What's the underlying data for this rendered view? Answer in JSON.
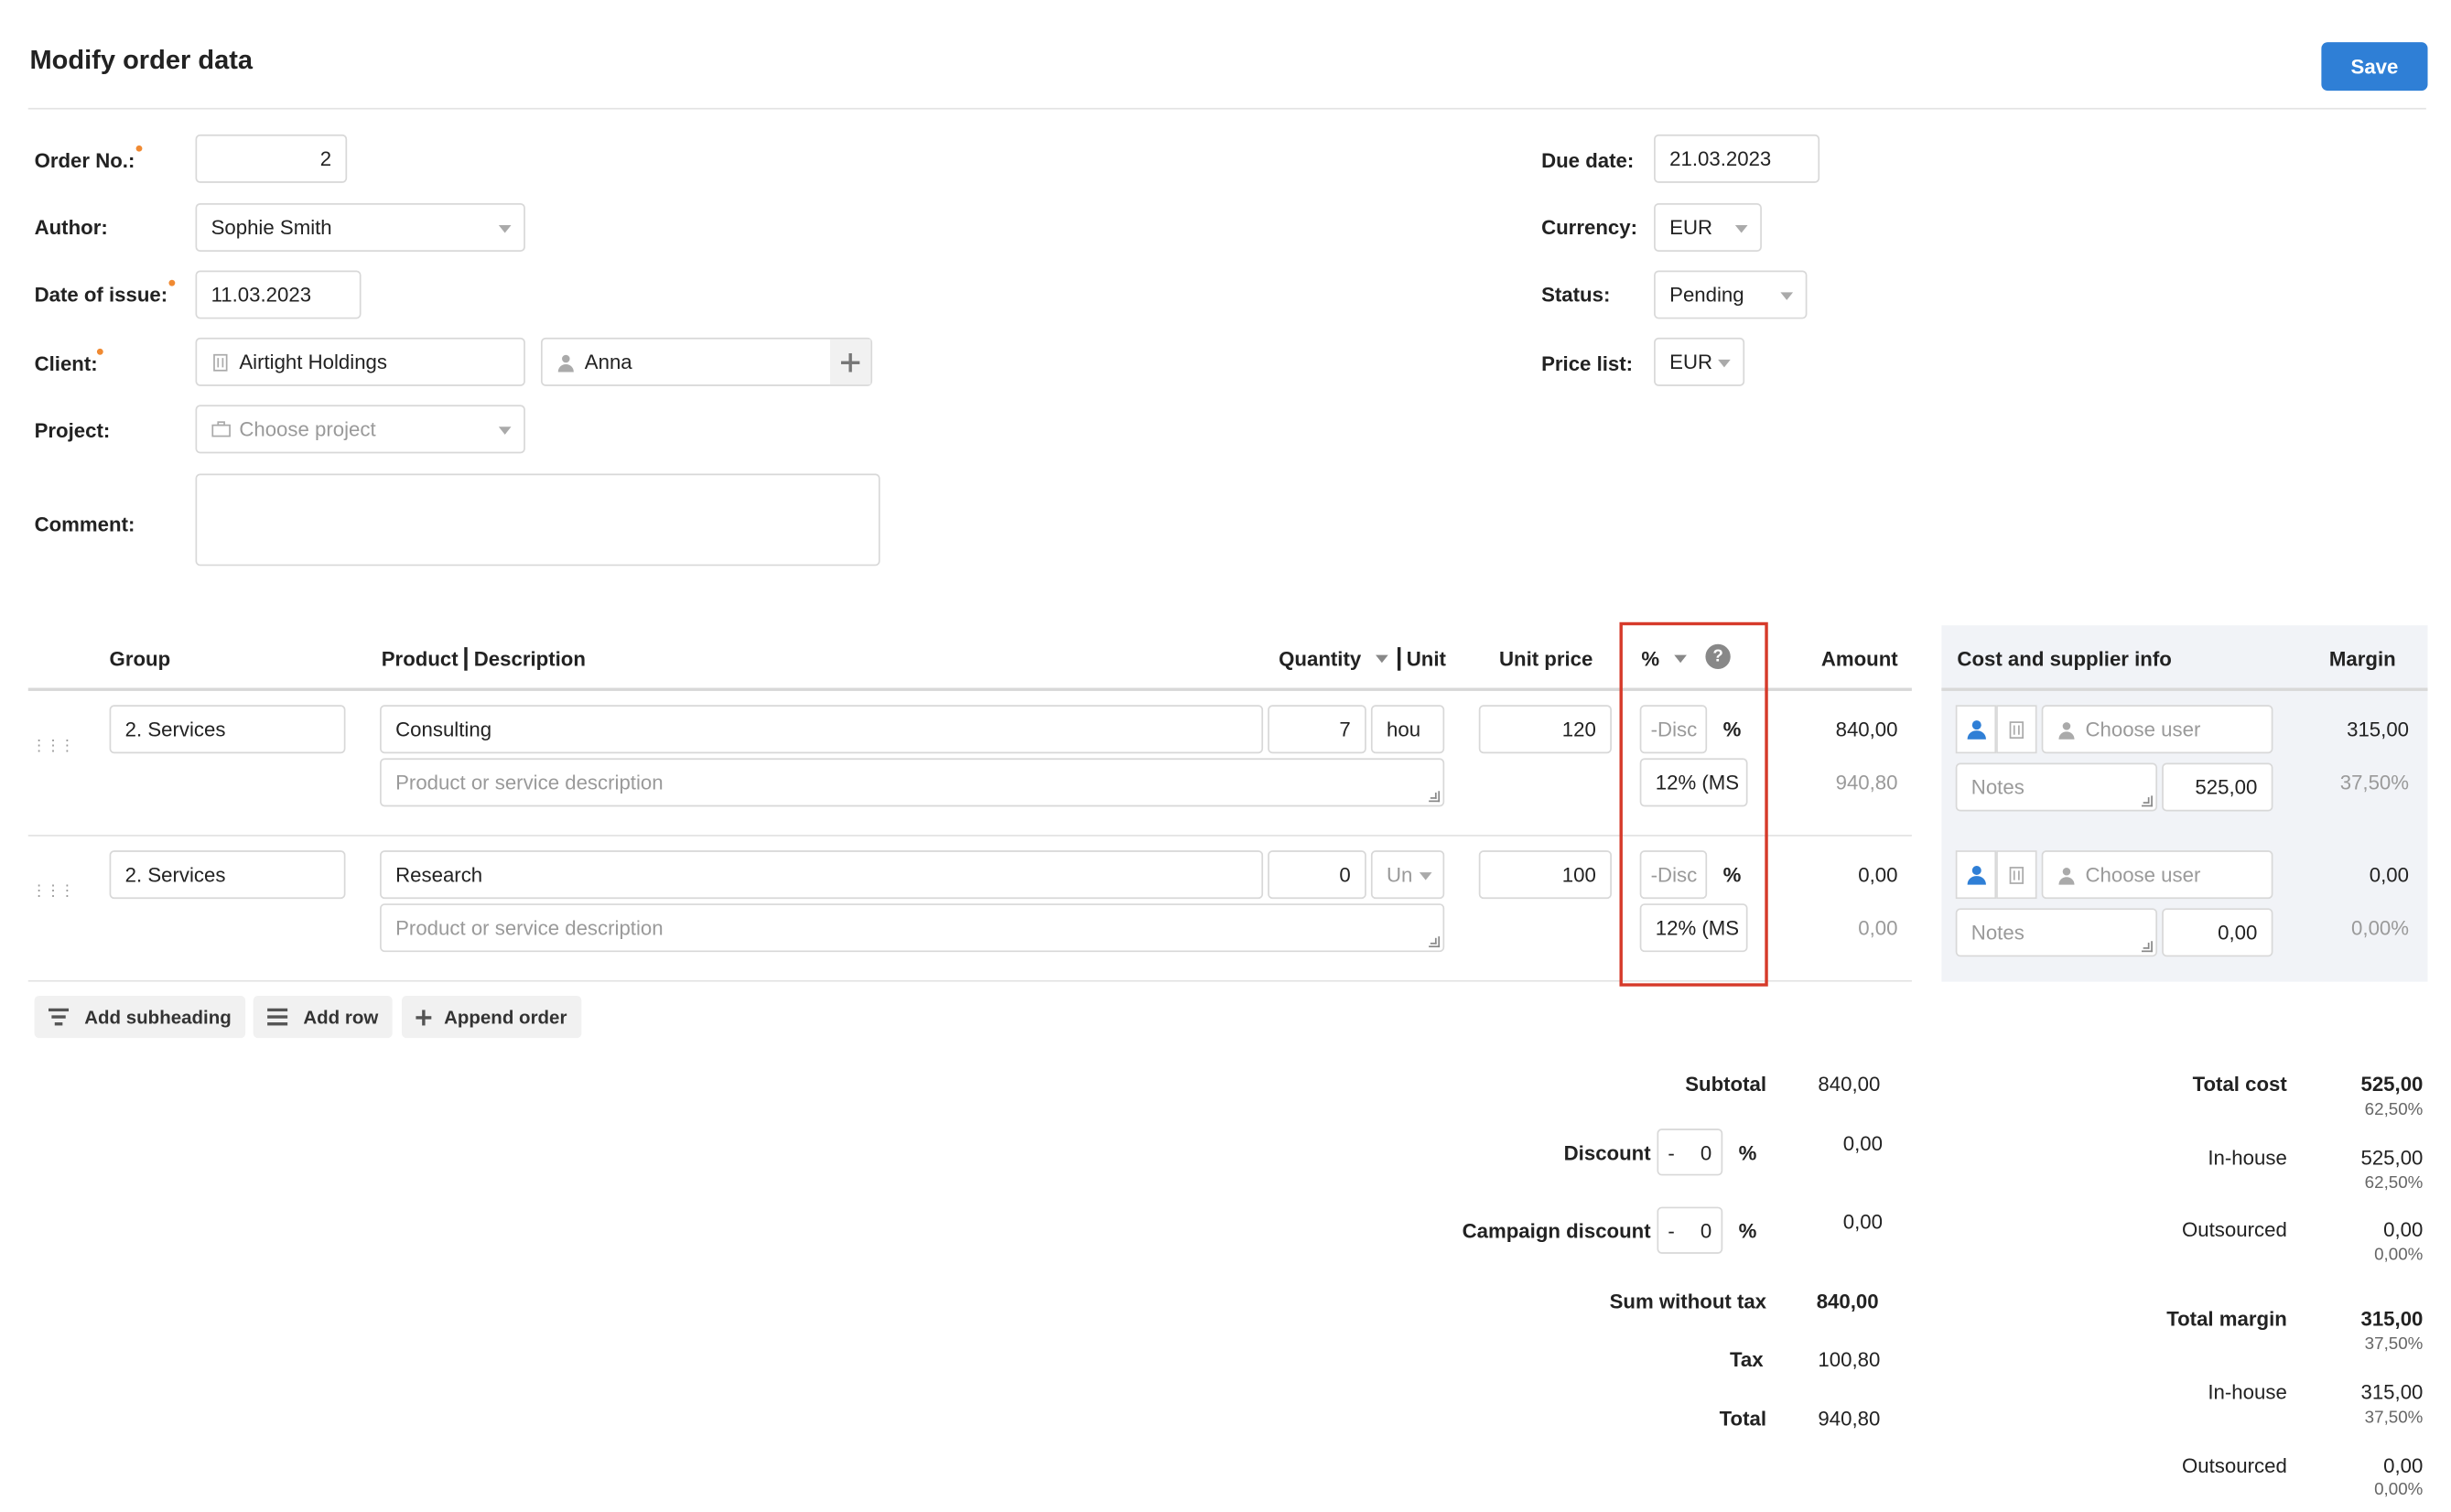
{
  "header": {
    "title": "Modify order data",
    "save_label": "Save"
  },
  "form": {
    "order_no_label": "Order No.:",
    "order_no_value": "2",
    "author_label": "Author:",
    "author_value": "Sophie Smith",
    "date_issue_label": "Date of issue:",
    "date_issue_value": "11.03.2023",
    "client_label": "Client:",
    "client_company": "Airtight Holdings",
    "client_contact": "Anna",
    "project_label": "Project:",
    "project_placeholder": "Choose project",
    "comment_label": "Comment:",
    "comment_value": "",
    "due_date_label": "Due date:",
    "due_date_value": "21.03.2023",
    "currency_label": "Currency:",
    "currency_value": "EUR",
    "status_label": "Status:",
    "status_value": "Pending",
    "price_list_label": "Price list:",
    "price_list_value": "EUR"
  },
  "table": {
    "headers": {
      "group": "Group",
      "product": "Product",
      "description": "Description",
      "quantity": "Quantity",
      "unit": "Unit",
      "unit_price": "Unit price",
      "percent": "%",
      "amount": "Amount",
      "cost_supplier": "Cost and supplier info",
      "margin": "Margin"
    },
    "rows": [
      {
        "group": "2. Services",
        "product": "Consulting",
        "description_placeholder": "Product or service description",
        "quantity": "7",
        "unit": "hou",
        "unit_price": "120",
        "discount_placeholder": "-Disc",
        "pct_label": "%",
        "tax": "12% (MS",
        "amount": "840,00",
        "amount_tax": "940,80",
        "user_placeholder": "Choose user",
        "notes_placeholder": "Notes",
        "cost": "525,00",
        "margin": "315,00",
        "margin_pct": "37,50%"
      },
      {
        "group": "2. Services",
        "product": "Research",
        "description_placeholder": "Product or service description",
        "quantity": "0",
        "unit": "Un",
        "unit_price": "100",
        "discount_placeholder": "-Disc",
        "pct_label": "%",
        "tax": "12% (MS",
        "amount": "0,00",
        "amount_tax": "0,00",
        "user_placeholder": "Choose user",
        "notes_placeholder": "Notes",
        "cost": "0,00",
        "margin": "0,00",
        "margin_pct": "0,00%"
      }
    ]
  },
  "actions": {
    "add_subheading": "Add subheading",
    "add_row": "Add row",
    "append_order": "Append order"
  },
  "totals": {
    "subtotal_label": "Subtotal",
    "subtotal": "840,00",
    "discount_label": "Discount",
    "discount_sign": "-",
    "discount_value": "0",
    "discount_pct": "%",
    "discount_amount": "0,00",
    "campaign_label": "Campaign discount",
    "campaign_sign": "-",
    "campaign_value": "0",
    "campaign_pct": "%",
    "campaign_amount": "0,00",
    "sum_wo_tax_label": "Sum without tax",
    "sum_wo_tax": "840,00",
    "tax_label": "Tax",
    "tax": "100,80",
    "total_label": "Total",
    "total": "940,80"
  },
  "cost_summary": {
    "total_cost_label": "Total cost",
    "total_cost": "525,00",
    "total_cost_pct": "62,50%",
    "inhouse_label": "In-house",
    "inhouse_cost": "525,00",
    "inhouse_cost_pct": "62,50%",
    "outsourced_label": "Outsourced",
    "outsourced_cost": "0,00",
    "outsourced_cost_pct": "0,00%",
    "total_margin_label": "Total margin",
    "total_margin": "315,00",
    "total_margin_pct": "37,50%",
    "inhouse_margin_label": "In-house",
    "inhouse_margin": "315,00",
    "inhouse_margin_pct": "37,50%",
    "outsourced_margin_label": "Outsourced",
    "outsourced_margin": "0,00",
    "outsourced_margin_pct": "0,00%"
  },
  "colors": {
    "accent": "#2f7fd6",
    "highlight_border": "#d63a2a",
    "required_dot": "#f08a32"
  }
}
